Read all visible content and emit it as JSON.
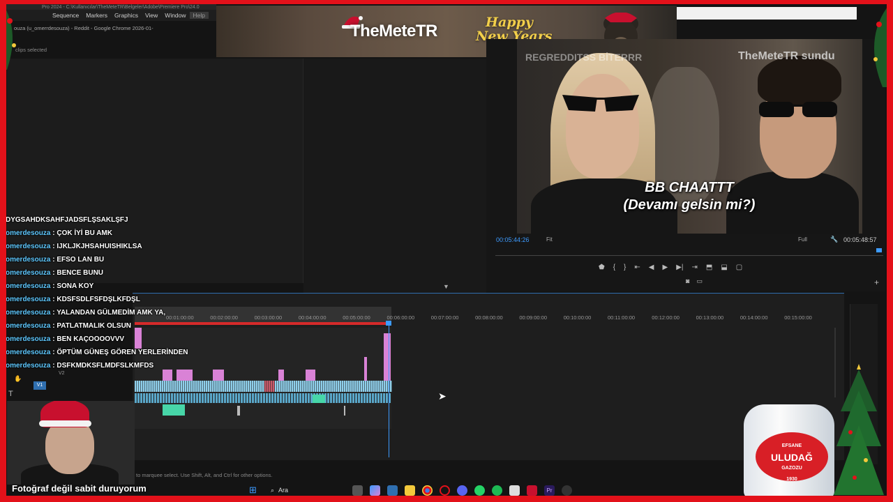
{
  "premiere": {
    "titlebar": "Pro 2024 - C:\\Kullanıcılar\\TheMeteTR\\Belgeler\\Adobe\\Premiere Pro\\24.0",
    "menu": [
      "Sequence",
      "Markers",
      "Graphics",
      "View",
      "Window",
      "Help"
    ],
    "clip_status": "clips selected",
    "program_timecode": "00:05:44:26",
    "fit_label": "Fit",
    "quality_label": "Full",
    "duration_timecode": "00:05:48:57",
    "status_hint": "to marquee select. Use Shift, Alt, and Ctrl for other options.",
    "ruler_ticks": [
      "00:01:00:00",
      "00:02:00:00",
      "00:03:00:00",
      "00:04:00:00",
      "00:05:00:00",
      "00:06:00:00",
      "00:07:00:00",
      "00:08:00:00",
      "00:09:00:00",
      "00:10:00:00",
      "00:11:00:00",
      "00:12:00:00",
      "00:13:00:00",
      "00:14:00:00",
      "00:15:00:00"
    ],
    "track_labels": [
      "V2",
      "V1"
    ]
  },
  "browser_tab": "ouza (u_omerrdesouza) - Reddit - Google Chrome 2026-01-",
  "banner": {
    "title": "TheMeteTR",
    "subtitle_line1": "Happy",
    "subtitle_line2": "New Years"
  },
  "video": {
    "watermark_left": "REGREDDITSS BİTERRR",
    "watermark_right": "TheMeteTR sundu",
    "caption_line1": "BB CHAATTT",
    "caption_line2": "(Devamı gelsin mi?)"
  },
  "chat": [
    {
      "user": "",
      "message": "DYGSAHDKSAHFJADSFLŞSAKLŞFJ"
    },
    {
      "user": "omerdesouza",
      "message": "ÇOK İYİ BU AMK"
    },
    {
      "user": "omerdesouza",
      "message": "IJKLJKJHSAHUISHIKLSA"
    },
    {
      "user": "omerdesouza",
      "message": "EFSO LAN BU"
    },
    {
      "user": "omerdesouza",
      "message": "BENCE BUNU"
    },
    {
      "user": "omerdesouza",
      "message": "SONA KOY"
    },
    {
      "user": "omerdesouza",
      "message": "KDSFSDLFSFDŞLKFDŞL"
    },
    {
      "user": "omerdesouza",
      "message": "YALANDAN GÜLMEDİM AMK YA,"
    },
    {
      "user": "omerdesouza",
      "message": "PATLATMALIK OLSUN"
    },
    {
      "user": "omerdesouza",
      "message": "BEN KAÇOOOOVVV"
    },
    {
      "user": "omerdesouza",
      "message": "ÖPTÜM GÜNEŞ GÖREN YERLERİNDEN"
    },
    {
      "user": "omerdesouza",
      "message": "DSFKMDKSFLMDFSLKMFDS"
    }
  ],
  "webcam_caption": "Fotoğraf değil sabit duruyorum",
  "taskbar": {
    "search_placeholder": "Ara",
    "icons": [
      "windows-icon",
      "search-icon",
      "task-view-icon",
      "copilot-icon",
      "store-icon",
      "file-explorer-icon",
      "chrome-icon",
      "opera-icon",
      "discord-icon",
      "whatsapp-icon",
      "spotify-icon",
      "calendar-icon",
      "adobe-icon",
      "premiere-icon",
      "obs-icon"
    ]
  },
  "bottle": {
    "brand_top": "EFSANE",
    "brand": "ULUDAĞ",
    "brand_bottom": "GAZOZU",
    "year": "1930"
  },
  "colors": {
    "frame": "#e3111a",
    "accent_blue": "#3d9bff",
    "chat_user": "#5ec8ff",
    "clip_video": "#8fd0ec",
    "clip_pink": "#d982d6",
    "clip_green": "#47d6a8"
  }
}
